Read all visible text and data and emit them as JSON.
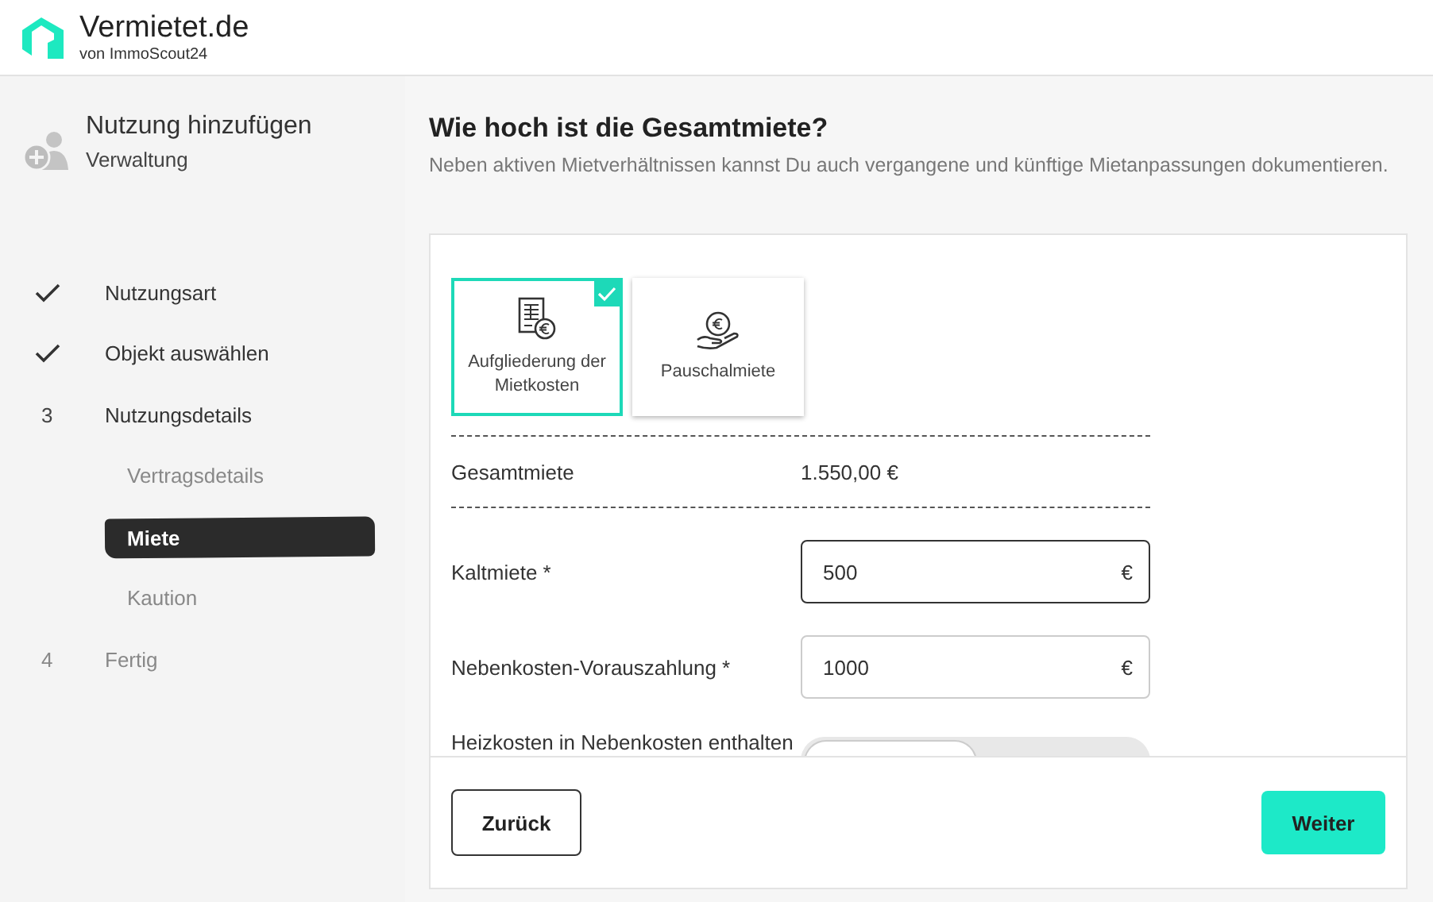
{
  "header": {
    "brand": "Vermietet.de",
    "tagline": "von ImmoScout24"
  },
  "sidebar": {
    "title": "Nutzung hinzufügen",
    "subtitle": "Verwaltung",
    "steps": [
      {
        "kind": "step",
        "done": true,
        "disabled": false,
        "label": "Nutzungsart"
      },
      {
        "kind": "step",
        "done": true,
        "disabled": false,
        "label": "Objekt auswählen"
      },
      {
        "kind": "step",
        "done": false,
        "disabled": false,
        "number": "3",
        "label": "Nutzungsdetails"
      },
      {
        "kind": "sub",
        "selected": false,
        "label": "Vertragsdetails"
      },
      {
        "kind": "sub",
        "selected": true,
        "label": "Miete"
      },
      {
        "kind": "sub",
        "selected": false,
        "label": "Kaution"
      },
      {
        "kind": "step",
        "done": false,
        "disabled": true,
        "number": "4",
        "label": "Fertig"
      }
    ]
  },
  "page": {
    "title": "Wie hoch ist die Gesamtmiete?",
    "description": "Neben aktiven Mietverhältnissen kannst Du auch vergangene und künftige Mietanpassungen dokumentieren."
  },
  "options": [
    {
      "label": "Aufgliederung der Mietkosten",
      "selected": true
    },
    {
      "label": "Pauschalmiete",
      "selected": false
    }
  ],
  "total": {
    "label": "Gesamtmiete",
    "value": "1.550,00 €"
  },
  "fields": [
    {
      "label": "Kaltmiete *",
      "value": "500",
      "unit": "€",
      "focused": true
    },
    {
      "label": "Nebenkosten-Vorauszahlung *",
      "value": "1000",
      "unit": "€",
      "focused": false
    }
  ],
  "heating": {
    "label": "Heizkosten in Nebenkosten enthalten",
    "toggle": [
      {
        "selected": true
      },
      {
        "selected": false
      }
    ]
  },
  "footer": {
    "back": "Zurück",
    "next": "Weiter"
  }
}
